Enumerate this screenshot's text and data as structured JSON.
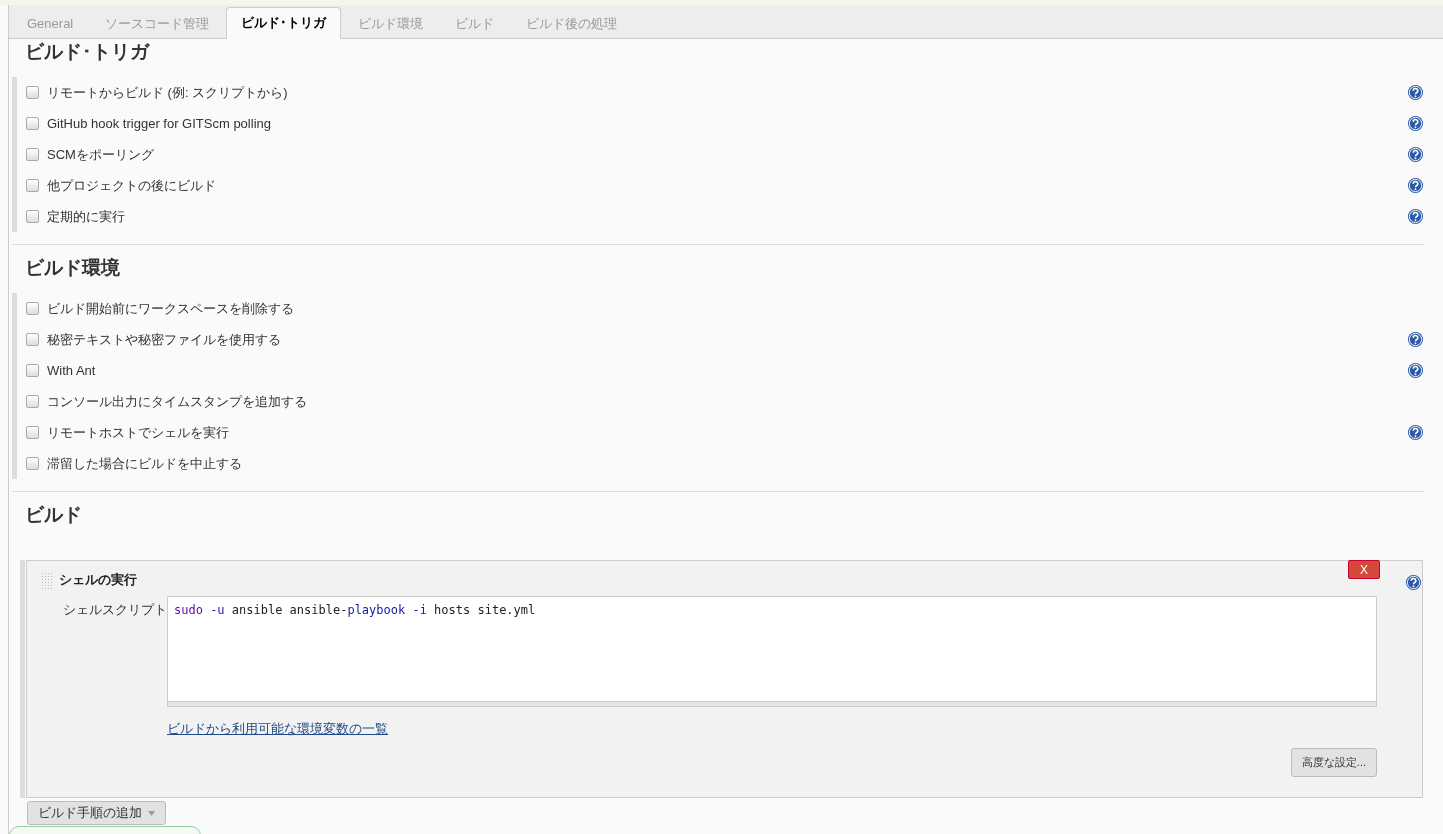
{
  "tabs": [
    {
      "label": "General",
      "selected": false
    },
    {
      "label": "ソースコード管理",
      "selected": false
    },
    {
      "label": "ビルド･トリガ",
      "selected": true
    },
    {
      "label": "ビルド環境",
      "selected": false
    },
    {
      "label": "ビルド",
      "selected": false
    },
    {
      "label": "ビルド後の処理",
      "selected": false
    }
  ],
  "sections": [
    {
      "title": "ビルド･トリガ",
      "options": [
        {
          "label": "リモートからビルド (例: スクリプトから)",
          "checked": false,
          "help": true
        },
        {
          "label": "GitHub hook trigger for GITScm polling",
          "checked": false,
          "help": true
        },
        {
          "label": "SCMをポーリング",
          "checked": false,
          "help": true
        },
        {
          "label": "他プロジェクトの後にビルド",
          "checked": false,
          "help": true
        },
        {
          "label": "定期的に実行",
          "checked": false,
          "help": true
        }
      ]
    },
    {
      "title": "ビルド環境",
      "options": [
        {
          "label": "ビルド開始前にワークスペースを削除する",
          "checked": false,
          "help": false
        },
        {
          "label": "秘密テキストや秘密ファイルを使用する",
          "checked": false,
          "help": true
        },
        {
          "label": "With Ant",
          "checked": false,
          "help": true
        },
        {
          "label": "コンソール出力にタイムスタンプを追加する",
          "checked": false,
          "help": false
        },
        {
          "label": "リモートホストでシェルを実行",
          "checked": false,
          "help": true
        },
        {
          "label": "滞留した場合にビルドを中止する",
          "checked": false,
          "help": false
        }
      ]
    }
  ],
  "build": {
    "title": "ビルド",
    "step": {
      "title": "シェルの実行",
      "delete_label": "X",
      "field_label": "シェルスクリプト",
      "script": [
        {
          "kind": "keyword",
          "text": "sudo "
        },
        {
          "kind": "option",
          "text": "-u"
        },
        {
          "kind": "plain",
          "text": " ansible ansible-"
        },
        {
          "kind": "option",
          "text": "playbook -i"
        },
        {
          "kind": "plain",
          "text": " hosts site.yml"
        }
      ],
      "link": "ビルドから利用可能な環境変数の一覧",
      "advanced_button": "高度な設定..."
    },
    "add_step_button": "ビルド手順の追加"
  }
}
